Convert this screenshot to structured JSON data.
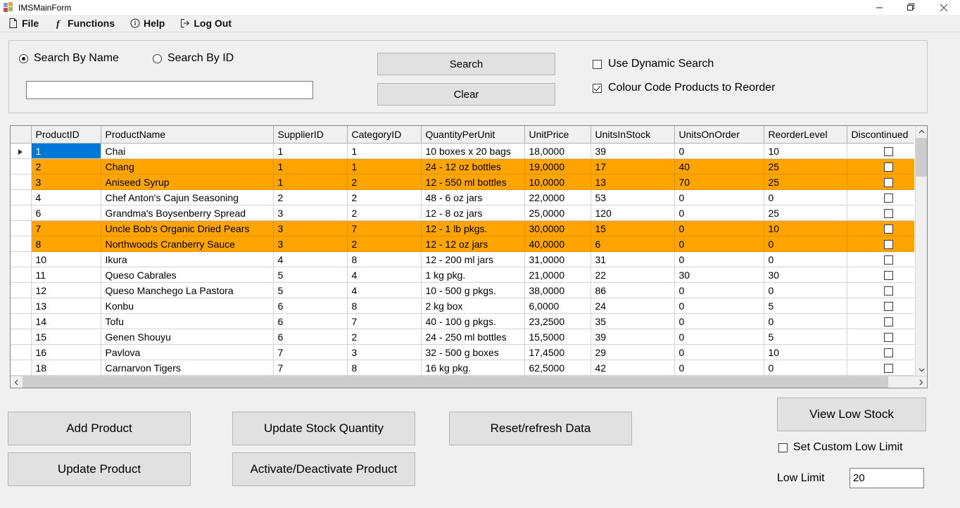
{
  "window": {
    "title": "IMSMainForm",
    "app_icon": "app-grid-icon",
    "minimize_label": "Minimize",
    "maximize_label": "Restore",
    "close_label": "Close"
  },
  "menubar": {
    "items": [
      {
        "label": "File",
        "icon": "document-icon"
      },
      {
        "label": "Functions",
        "icon": "function-f-icon"
      },
      {
        "label": "Help",
        "icon": "info-circle-icon"
      },
      {
        "label": "Log Out",
        "icon": "logout-arrow-icon"
      }
    ]
  },
  "search": {
    "radio_name_label": "Search By Name",
    "radio_name_checked": true,
    "radio_id_label": "Search By ID",
    "radio_id_checked": false,
    "input_value": "",
    "input_placeholder": "",
    "search_button": "Search",
    "clear_button": "Clear",
    "dynamic_checkbox_label": "Use Dynamic Search",
    "dynamic_checkbox_checked": false,
    "colour_checkbox_label": "Colour Code Products to Reorder",
    "colour_checkbox_checked": true
  },
  "grid": {
    "columns": [
      "ProductID",
      "ProductName",
      "SupplierID",
      "CategoryID",
      "QuantityPerUnit",
      "UnitPrice",
      "UnitsInStock",
      "UnitsOnOrder",
      "ReorderLevel",
      "Discontinued"
    ],
    "selected_cell": {
      "row": 0,
      "column": 0
    },
    "current_row_indicator": 0,
    "highlight_color": "#ffa400",
    "selection_color": "#0078d7",
    "rows": [
      {
        "ProductID": "1",
        "ProductName": "Chai",
        "SupplierID": "1",
        "CategoryID": "1",
        "QuantityPerUnit": "10 boxes x 20 bags",
        "UnitPrice": "18,0000",
        "UnitsInStock": "39",
        "UnitsOnOrder": "0",
        "ReorderLevel": "10",
        "Discontinued": false,
        "highlight": false
      },
      {
        "ProductID": "2",
        "ProductName": "Chang",
        "SupplierID": "1",
        "CategoryID": "1",
        "QuantityPerUnit": "24 - 12 oz bottles",
        "UnitPrice": "19,0000",
        "UnitsInStock": "17",
        "UnitsOnOrder": "40",
        "ReorderLevel": "25",
        "Discontinued": false,
        "highlight": true
      },
      {
        "ProductID": "3",
        "ProductName": "Aniseed Syrup",
        "SupplierID": "1",
        "CategoryID": "2",
        "QuantityPerUnit": "12 - 550 ml bottles",
        "UnitPrice": "10,0000",
        "UnitsInStock": "13",
        "UnitsOnOrder": "70",
        "ReorderLevel": "25",
        "Discontinued": false,
        "highlight": true
      },
      {
        "ProductID": "4",
        "ProductName": "Chef Anton's Cajun Seasoning",
        "SupplierID": "2",
        "CategoryID": "2",
        "QuantityPerUnit": "48 - 6 oz jars",
        "UnitPrice": "22,0000",
        "UnitsInStock": "53",
        "UnitsOnOrder": "0",
        "ReorderLevel": "0",
        "Discontinued": false,
        "highlight": false
      },
      {
        "ProductID": "6",
        "ProductName": "Grandma's Boysenberry Spread",
        "SupplierID": "3",
        "CategoryID": "2",
        "QuantityPerUnit": "12 - 8 oz jars",
        "UnitPrice": "25,0000",
        "UnitsInStock": "120",
        "UnitsOnOrder": "0",
        "ReorderLevel": "25",
        "Discontinued": false,
        "highlight": false
      },
      {
        "ProductID": "7",
        "ProductName": "Uncle Bob's Organic Dried Pears",
        "SupplierID": "3",
        "CategoryID": "7",
        "QuantityPerUnit": "12 - 1 lb pkgs.",
        "UnitPrice": "30,0000",
        "UnitsInStock": "15",
        "UnitsOnOrder": "0",
        "ReorderLevel": "10",
        "Discontinued": false,
        "highlight": true
      },
      {
        "ProductID": "8",
        "ProductName": "Northwoods Cranberry Sauce",
        "SupplierID": "3",
        "CategoryID": "2",
        "QuantityPerUnit": "12 - 12 oz jars",
        "UnitPrice": "40,0000",
        "UnitsInStock": "6",
        "UnitsOnOrder": "0",
        "ReorderLevel": "0",
        "Discontinued": false,
        "highlight": true
      },
      {
        "ProductID": "10",
        "ProductName": "Ikura",
        "SupplierID": "4",
        "CategoryID": "8",
        "QuantityPerUnit": "12 - 200 ml jars",
        "UnitPrice": "31,0000",
        "UnitsInStock": "31",
        "UnitsOnOrder": "0",
        "ReorderLevel": "0",
        "Discontinued": false,
        "highlight": false
      },
      {
        "ProductID": "11",
        "ProductName": "Queso Cabrales",
        "SupplierID": "5",
        "CategoryID": "4",
        "QuantityPerUnit": "1 kg pkg.",
        "UnitPrice": "21,0000",
        "UnitsInStock": "22",
        "UnitsOnOrder": "30",
        "ReorderLevel": "30",
        "Discontinued": false,
        "highlight": false
      },
      {
        "ProductID": "12",
        "ProductName": "Queso Manchego La Pastora",
        "SupplierID": "5",
        "CategoryID": "4",
        "QuantityPerUnit": "10 - 500 g pkgs.",
        "UnitPrice": "38,0000",
        "UnitsInStock": "86",
        "UnitsOnOrder": "0",
        "ReorderLevel": "0",
        "Discontinued": false,
        "highlight": false
      },
      {
        "ProductID": "13",
        "ProductName": "Konbu",
        "SupplierID": "6",
        "CategoryID": "8",
        "QuantityPerUnit": "2 kg box",
        "UnitPrice": "6,0000",
        "UnitsInStock": "24",
        "UnitsOnOrder": "0",
        "ReorderLevel": "5",
        "Discontinued": false,
        "highlight": false
      },
      {
        "ProductID": "14",
        "ProductName": "Tofu",
        "SupplierID": "6",
        "CategoryID": "7",
        "QuantityPerUnit": "40 - 100 g pkgs.",
        "UnitPrice": "23,2500",
        "UnitsInStock": "35",
        "UnitsOnOrder": "0",
        "ReorderLevel": "0",
        "Discontinued": false,
        "highlight": false
      },
      {
        "ProductID": "15",
        "ProductName": "Genen Shouyu",
        "SupplierID": "6",
        "CategoryID": "2",
        "QuantityPerUnit": "24 - 250 ml bottles",
        "UnitPrice": "15,5000",
        "UnitsInStock": "39",
        "UnitsOnOrder": "0",
        "ReorderLevel": "5",
        "Discontinued": false,
        "highlight": false
      },
      {
        "ProductID": "16",
        "ProductName": "Pavlova",
        "SupplierID": "7",
        "CategoryID": "3",
        "QuantityPerUnit": "32 - 500 g boxes",
        "UnitPrice": "17,4500",
        "UnitsInStock": "29",
        "UnitsOnOrder": "0",
        "ReorderLevel": "10",
        "Discontinued": false,
        "highlight": false
      },
      {
        "ProductID": "18",
        "ProductName": "Carnarvon Tigers",
        "SupplierID": "7",
        "CategoryID": "8",
        "QuantityPerUnit": "16 kg pkg.",
        "UnitPrice": "62,5000",
        "UnitsInStock": "42",
        "UnitsOnOrder": "0",
        "ReorderLevel": "0",
        "Discontinued": false,
        "highlight": false
      }
    ]
  },
  "actions": {
    "add_product": "Add Product",
    "update_product": "Update Product",
    "update_stock_quantity": "Update Stock Quantity",
    "activate_deactivate_product": "Activate/Deactivate Product",
    "reset_refresh_data": "Reset/refresh Data",
    "view_low_stock": "View Low Stock",
    "set_custom_low_limit_label": "Set Custom Low Limit",
    "set_custom_low_limit_checked": false,
    "low_limit_label": "Low Limit",
    "low_limit_value": "20"
  }
}
